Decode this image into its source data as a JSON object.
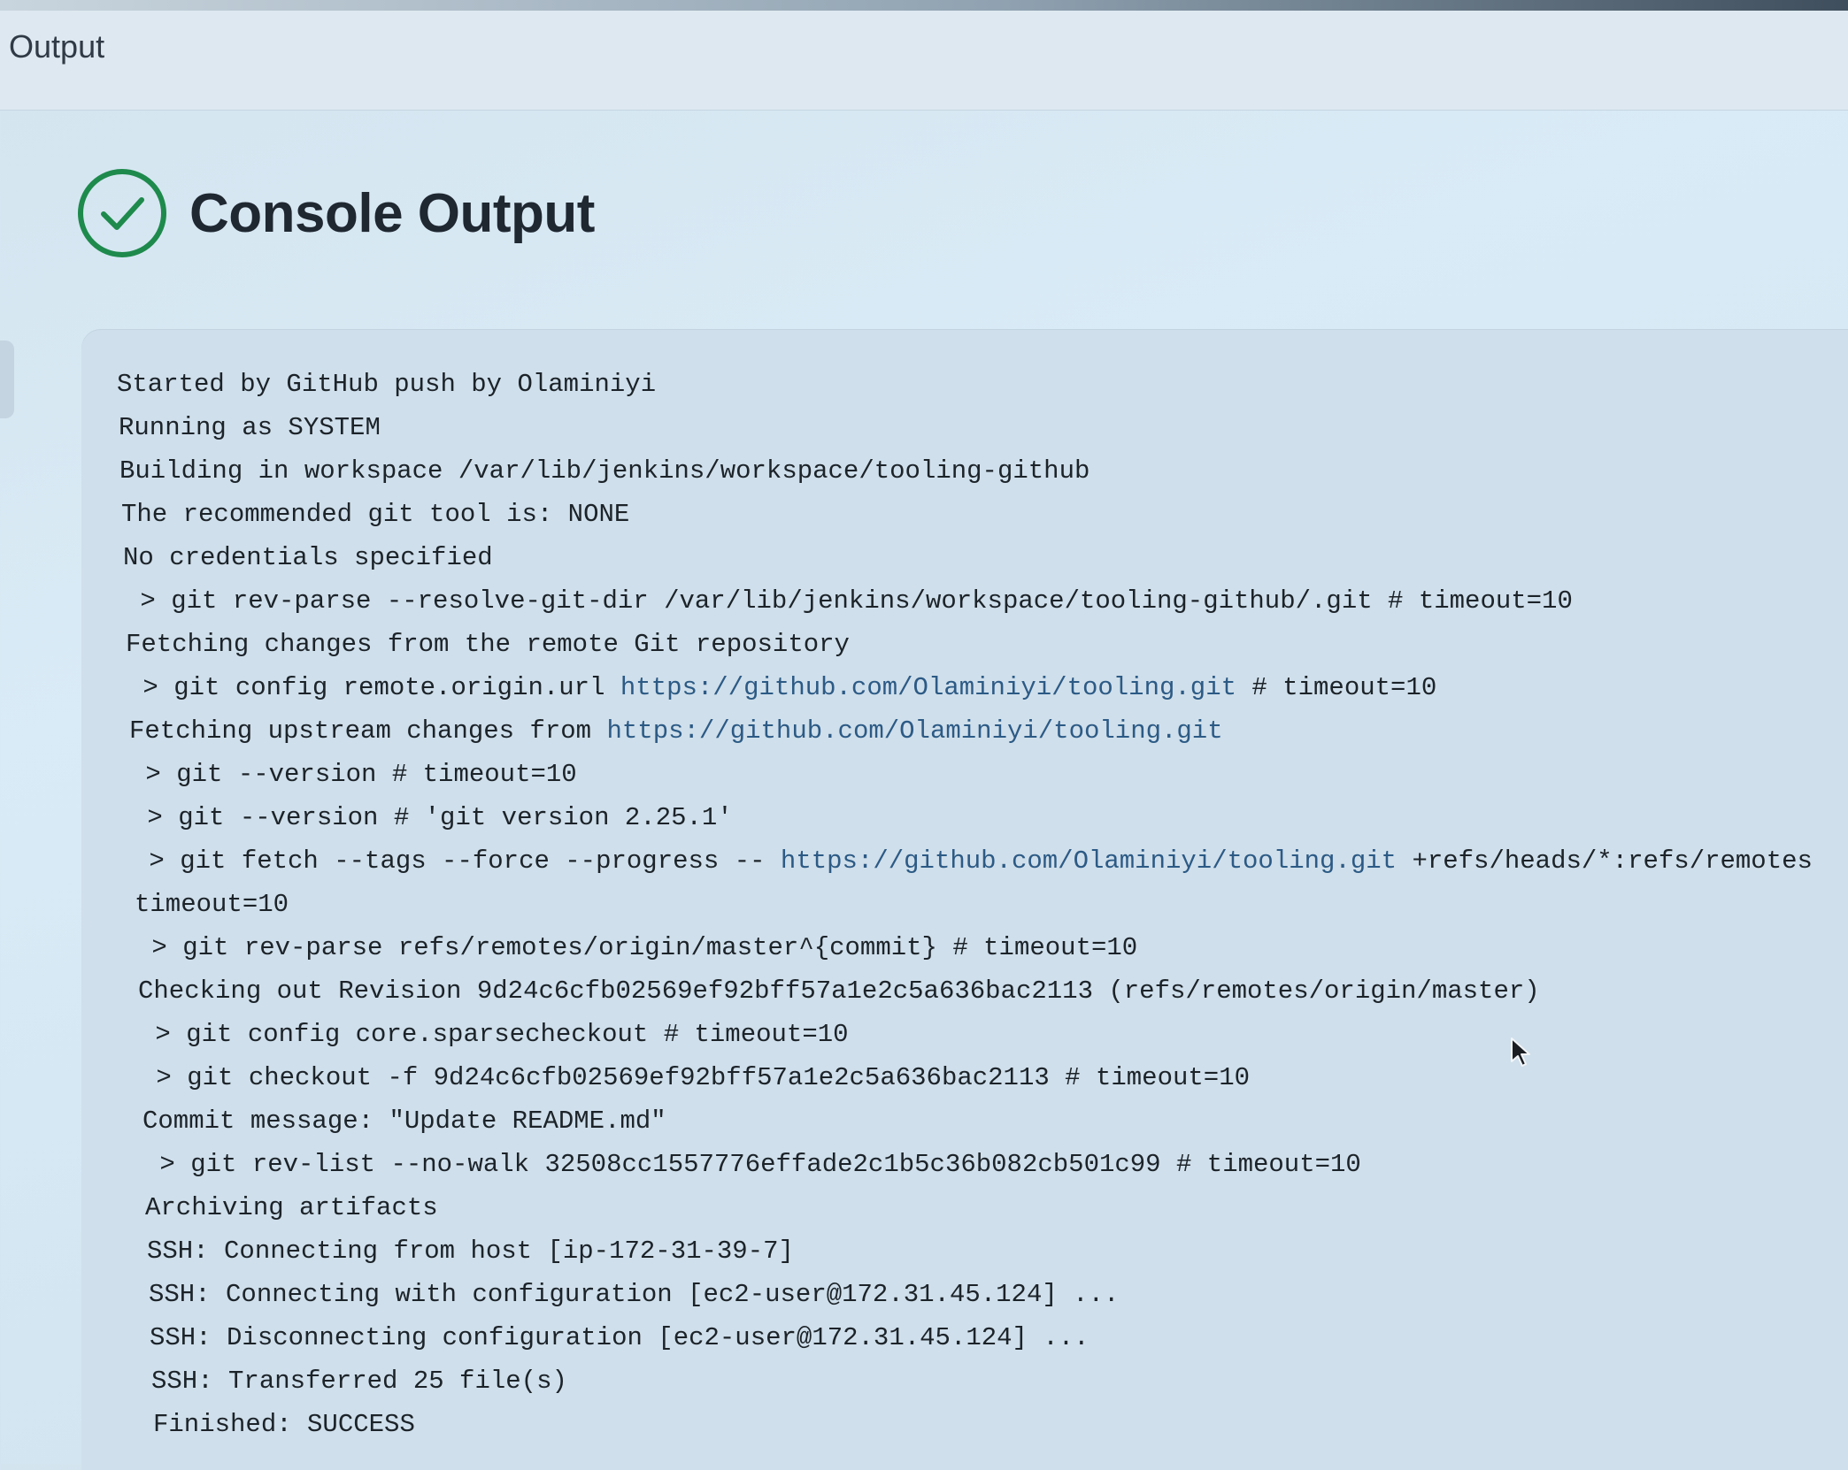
{
  "breadcrumb": {
    "current": "le Output"
  },
  "page": {
    "title": "Console Output",
    "status_icon": "success-check-circle-icon",
    "status_color": "#1e8a4c"
  },
  "console": {
    "lines": [
      {
        "parts": [
          {
            "t": "Started by GitHub push by Olaminiyi"
          }
        ]
      },
      {
        "parts": [
          {
            "t": "Running as SYSTEM"
          }
        ]
      },
      {
        "parts": [
          {
            "t": "Building in workspace /var/lib/jenkins/workspace/tooling-github"
          }
        ]
      },
      {
        "parts": [
          {
            "t": "The recommended git tool is: NONE"
          }
        ]
      },
      {
        "parts": [
          {
            "t": "No credentials specified"
          }
        ]
      },
      {
        "parts": [
          {
            "t": " > git rev-parse --resolve-git-dir /var/lib/jenkins/workspace/tooling-github/.git # timeout=10"
          }
        ]
      },
      {
        "parts": [
          {
            "t": "Fetching changes from the remote Git repository"
          }
        ]
      },
      {
        "parts": [
          {
            "t": " > git config remote.origin.url "
          },
          {
            "t": "https://github.com/Olaminiyi/tooling.git",
            "link": true
          },
          {
            "t": " # timeout=10"
          }
        ]
      },
      {
        "parts": [
          {
            "t": "Fetching upstream changes from "
          },
          {
            "t": "https://github.com/Olaminiyi/tooling.git",
            "link": true
          }
        ]
      },
      {
        "parts": [
          {
            "t": " > git --version # timeout=10"
          }
        ]
      },
      {
        "parts": [
          {
            "t": " > git --version # 'git version 2.25.1'"
          }
        ]
      },
      {
        "parts": [
          {
            "t": " > git fetch --tags --force --progress -- "
          },
          {
            "t": "https://github.com/Olaminiyi/tooling.git",
            "link": true
          },
          {
            "t": " +refs/heads/*:refs/remotes"
          }
        ]
      },
      {
        "parts": [
          {
            "t": "timeout=10"
          }
        ]
      },
      {
        "parts": [
          {
            "t": " > git rev-parse refs/remotes/origin/master^{commit} # timeout=10"
          }
        ]
      },
      {
        "parts": [
          {
            "t": "Checking out Revision 9d24c6cfb02569ef92bff57a1e2c5a636bac2113 (refs/remotes/origin/master)"
          }
        ]
      },
      {
        "parts": [
          {
            "t": " > git config core.sparsecheckout # timeout=10"
          }
        ]
      },
      {
        "parts": [
          {
            "t": " > git checkout -f 9d24c6cfb02569ef92bff57a1e2c5a636bac2113 # timeout=10"
          }
        ]
      },
      {
        "parts": [
          {
            "t": "Commit message: \"Update README.md\""
          }
        ]
      },
      {
        "parts": [
          {
            "t": " > git rev-list --no-walk 32508cc1557776effade2c1b5c36b082cb501c99 # timeout=10"
          }
        ]
      },
      {
        "parts": [
          {
            "t": "Archiving artifacts"
          }
        ]
      },
      {
        "parts": [
          {
            "t": "SSH: Connecting from host [ip-172-31-39-7]"
          }
        ]
      },
      {
        "parts": [
          {
            "t": "SSH: Connecting with configuration [ec2-user@172.31.45.124] ..."
          }
        ]
      },
      {
        "parts": [
          {
            "t": "SSH: Disconnecting configuration [ec2-user@172.31.45.124] ..."
          }
        ]
      },
      {
        "parts": [
          {
            "t": "SSH: Transferred 25 file(s)"
          }
        ]
      },
      {
        "parts": [
          {
            "t": "Finished: SUCCESS"
          }
        ]
      }
    ]
  }
}
